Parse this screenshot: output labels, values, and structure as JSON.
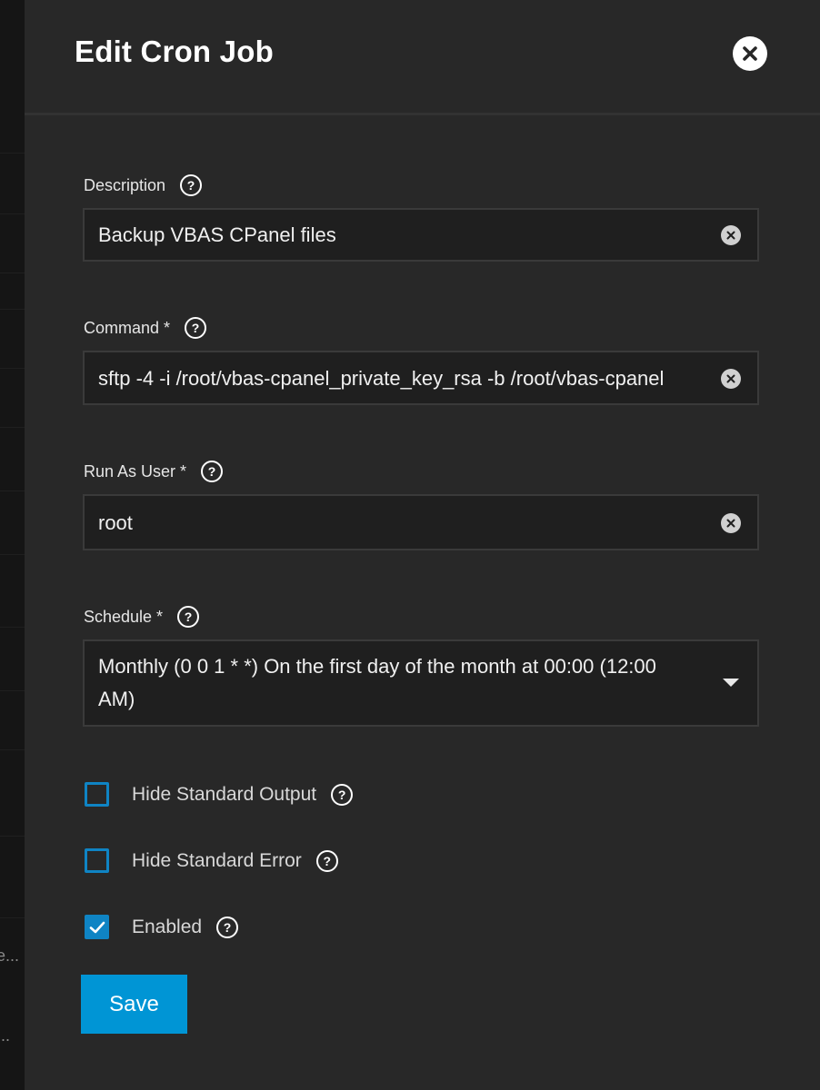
{
  "dialog": {
    "title": "Edit Cron Job",
    "close_icon": "close-icon"
  },
  "fields": {
    "description": {
      "label": "Description",
      "value": "Backup VBAS CPanel files"
    },
    "command": {
      "label": "Command *",
      "value": "sftp -4 -i /root/vbas-cpanel_private_key_rsa -b /root/vbas-cpanel"
    },
    "run_as_user": {
      "label": "Run As User *",
      "value": "root"
    },
    "schedule": {
      "label": "Schedule *",
      "value": "Monthly (0 0 1 * *)  On the first day of the month at 00:00 (12:00 AM)"
    }
  },
  "options": {
    "hide_stdout": {
      "label": "Hide Standard Output",
      "checked": false
    },
    "hide_stderr": {
      "label": "Hide Standard Error",
      "checked": false
    },
    "enabled": {
      "label": "Enabled",
      "checked": true
    }
  },
  "actions": {
    "save_label": "Save"
  },
  "background": {
    "ghost_text_1": "e...",
    "ghost_text_2": "..."
  },
  "colors": {
    "panel_bg": "#282828",
    "input_bg": "#1f1f1f",
    "accent": "#0095d5",
    "checkbox": "#0f84c4"
  }
}
